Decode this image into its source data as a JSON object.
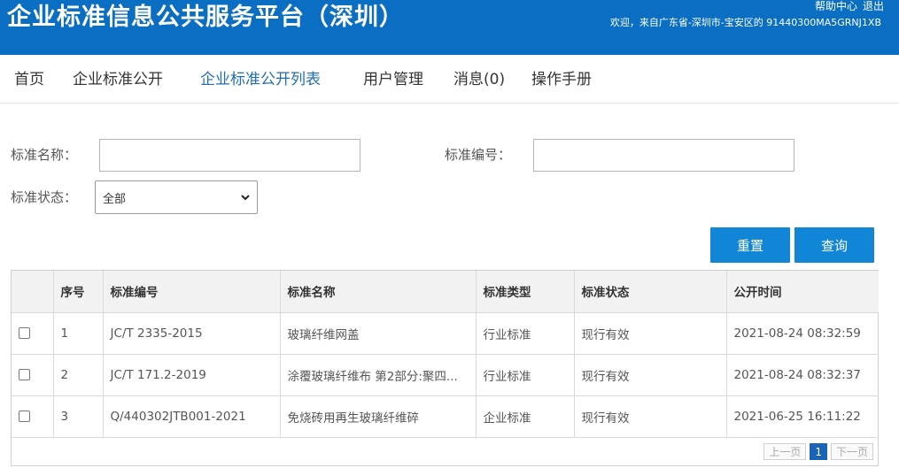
{
  "header": {
    "title": "企业标准信息公共服务平台（深圳）",
    "help_link": "帮助中心",
    "logout_link": "退出",
    "welcome": "欢迎，来自广东省-深圳市-宝安区的  91440300MA5GRNJ1XB"
  },
  "nav": {
    "items": [
      "首页",
      "企业标准公开",
      "企业标准公开列表",
      "用户管理",
      "消息(0)",
      "操作手册"
    ],
    "active": "企业标准公开列表"
  },
  "form": {
    "name_label": "标准名称：",
    "name_value": "",
    "code_label": "标准编号：",
    "code_value": "",
    "status_label": "标准状态：",
    "status_value": "全部"
  },
  "buttons": {
    "reset": "重置",
    "query": "查询"
  },
  "table": {
    "headers": [
      "",
      "序号",
      "标准编号",
      "标准名称",
      "标准类型",
      "标准状态",
      "公开时间"
    ],
    "rows": [
      [
        "1",
        "JC/T 2335-2015",
        "玻璃纤维网盖",
        "行业标准",
        "现行有效",
        "2021-08-24 08:32:59"
      ],
      [
        "2",
        "JC/T 171.2-2019",
        "涂覆玻璃纤维布 第2部分:聚四...",
        "行业标准",
        "现行有效",
        "2021-08-24 08:32:37"
      ],
      [
        "3",
        "Q/440302JTB001-2021",
        "免烧砖用再生玻璃纤维碎",
        "企业标准",
        "现行有效",
        "2021-06-25 16:11:22"
      ]
    ]
  },
  "pager": {
    "prev": "上一页",
    "current": "1",
    "next": "下一页"
  },
  "colors": {
    "header_bg": "#0a6fc2",
    "button_bg": "#1185d6",
    "active_nav": "#1f6db5"
  }
}
